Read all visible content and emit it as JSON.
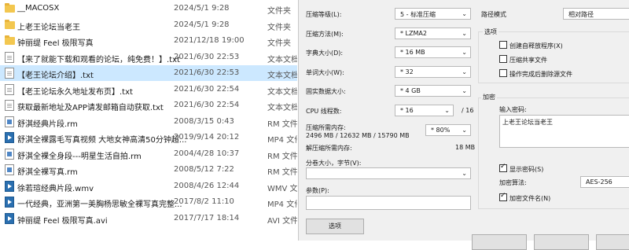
{
  "files": [
    {
      "name": "__MACOSX",
      "date": "2024/5/1 9:28",
      "type": "文件夹",
      "icon": "folder-icon",
      "selected": false
    },
    {
      "name": "上老王论坛当老王",
      "date": "2024/5/1 9:28",
      "type": "文件夹",
      "icon": "folder-icon",
      "selected": false
    },
    {
      "name": "钟丽缇 Feel 极限写真",
      "date": "2021/12/18 19:00",
      "type": "文件夹",
      "icon": "folder-icon",
      "selected": false
    },
    {
      "name": "【来了就能下载和观看的论坛，纯免费！】.txt",
      "date": "2021/6/30 22:53",
      "type": "文本文档",
      "icon": "text-file-icon",
      "selected": false
    },
    {
      "name": "【老王论坛介绍】.txt",
      "date": "2021/6/30 22:53",
      "type": "文本文档",
      "icon": "text-file-icon",
      "selected": true
    },
    {
      "name": "【老王论坛永久地址发布页】.txt",
      "date": "2021/6/30 22:54",
      "type": "文本文档",
      "icon": "text-file-icon",
      "selected": false
    },
    {
      "name": "获取最新地址及APP请发邮箱自动获取.txt",
      "date": "2021/6/30 22:54",
      "type": "文本文档",
      "icon": "text-file-icon",
      "selected": false
    },
    {
      "name": "舒淇经典片段.rm",
      "date": "2008/3/15 0:43",
      "type": "RM 文件",
      "icon": "rm-file-icon",
      "selected": false
    },
    {
      "name": "舒淇全裸露毛写真视频 大地女神高清50分钟超...",
      "date": "2019/9/14 20:12",
      "type": "MP4 文件",
      "icon": "video-file-icon",
      "selected": false
    },
    {
      "name": "舒淇全裸全身段---明星生活自拍.rm",
      "date": "2004/4/28 10:37",
      "type": "RM 文件",
      "icon": "rm-file-icon",
      "selected": false
    },
    {
      "name": "舒淇全裸写真.rm",
      "date": "2008/5/12 7:22",
      "type": "RM 文件",
      "icon": "rm-file-icon",
      "selected": false
    },
    {
      "name": "徐若瑄经典片段.wmv",
      "date": "2008/4/26 12:44",
      "type": "WMV 文件",
      "icon": "video-file-icon",
      "selected": false
    },
    {
      "name": "一代经典，亚洲第一美胸杨思敏全裸写真完整...",
      "date": "2017/8/2 11:10",
      "type": "MP4 文件",
      "icon": "video-file-icon",
      "selected": false
    },
    {
      "name": "钟丽缇 Feel 极限写真.avi",
      "date": "2017/7/17 18:14",
      "type": "AVI 文件",
      "icon": "video-file-icon",
      "selected": false
    }
  ],
  "dialog": {
    "compression_level": {
      "label": "压缩等级(L):",
      "value": "5 - 标准压缩"
    },
    "compression_method": {
      "label": "压缩方法(M):",
      "value": "* LZMA2"
    },
    "dictionary_size": {
      "label": "字典大小(D):",
      "value": "* 16 MB"
    },
    "word_size": {
      "label": "单词大小(W):",
      "value": "* 32"
    },
    "solid_block_size": {
      "label": "固实数据大小:",
      "value": "* 4 GB"
    },
    "cpu_threads": {
      "label": "CPU 线程数:",
      "value": "* 16",
      "total": "/ 16"
    },
    "memory_usage": {
      "label": "压缩所需内存:",
      "detail": "2496 MB / 12632 MB / 15790 MB",
      "value": "* 80%"
    },
    "decompress_memory": {
      "label": "解压缩所需内存:",
      "value": "18 MB"
    },
    "split_volumes": {
      "label": "分卷大小，字节(V):",
      "value": ""
    },
    "parameters": {
      "label": "参数(P):",
      "value": ""
    },
    "options_button": "选项",
    "path_mode": {
      "label": "路径模式",
      "value": "相对路径"
    },
    "options_group": {
      "title": "选项",
      "items": [
        {
          "label": "创建自释放程序(X)",
          "checked": false
        },
        {
          "label": "压缩共享文件",
          "checked": false
        },
        {
          "label": "操作完成后删除源文件",
          "checked": false
        }
      ]
    },
    "encryption": {
      "title": "加密",
      "password_label": "输入密码:",
      "password_value": "上老王论坛当老王",
      "show_password": {
        "label": "显示密码(S)",
        "checked": true
      },
      "method_label": "加密算法:",
      "method_value": "AES-256",
      "encrypt_names": {
        "label": "加密文件名(N)",
        "checked": true
      }
    }
  },
  "colors": {
    "selection": "#cce8ff",
    "dialog_bg": "#f0f0f0"
  }
}
